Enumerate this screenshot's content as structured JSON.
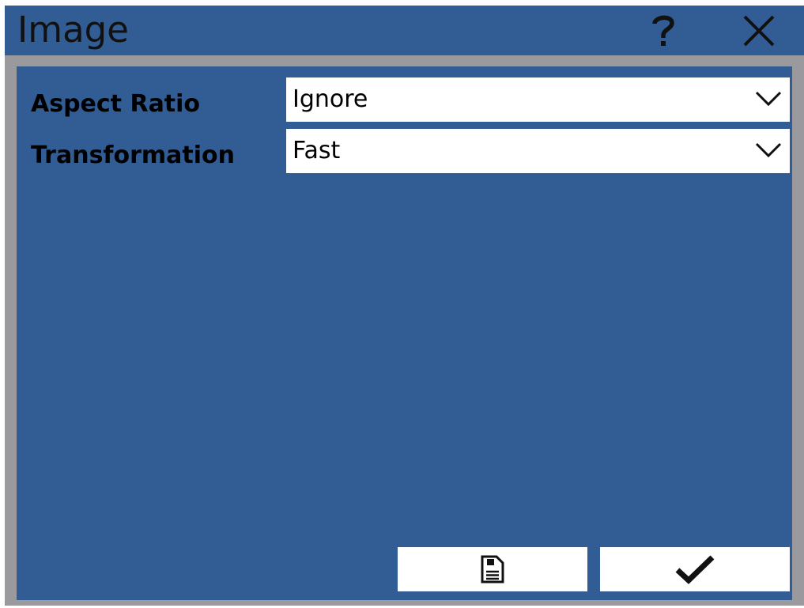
{
  "window": {
    "title": "Image",
    "help_icon": "question-mark-icon",
    "close_icon": "close-x-icon",
    "colors": {
      "titlebar": "#325d94",
      "frame": "#9a9a9e",
      "content": "#325d94",
      "field_background": "#ffffff",
      "text": "#000000"
    }
  },
  "form": {
    "aspect_ratio": {
      "label": "Aspect Ratio",
      "value": "Ignore",
      "dropdown_icon": "chevron-down-icon"
    },
    "transformation": {
      "label": "Transformation",
      "value": "Fast",
      "dropdown_icon": "chevron-down-icon"
    }
  },
  "footer": {
    "save_button": {
      "icon": "save-document-icon"
    },
    "ok_button": {
      "icon": "checkmark-icon"
    }
  }
}
